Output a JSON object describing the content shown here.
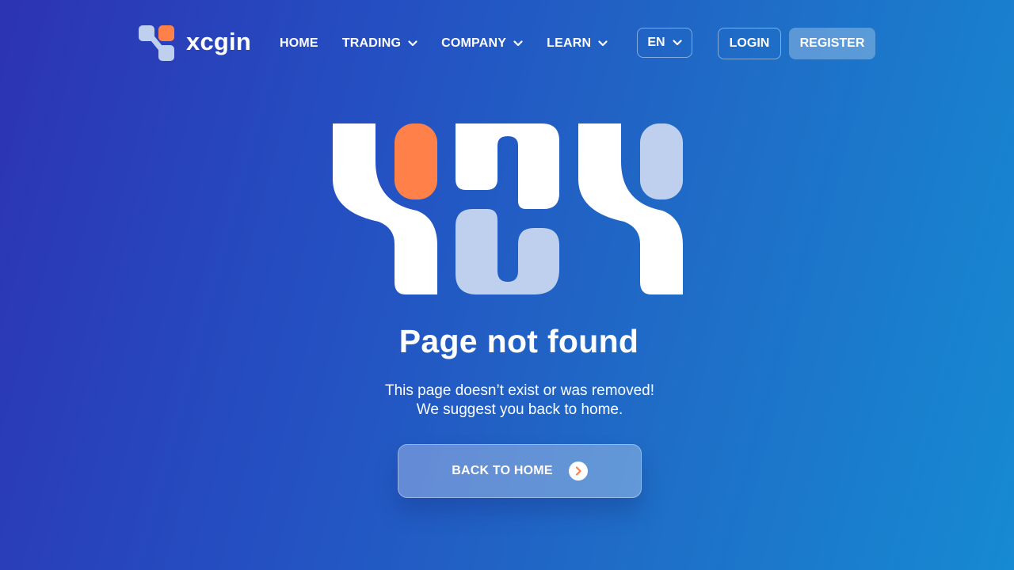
{
  "brand": {
    "name": "xcgin"
  },
  "nav": {
    "items": [
      {
        "label": "HOME",
        "dropdown": false
      },
      {
        "label": "TRADING",
        "dropdown": true
      },
      {
        "label": "COMPANY",
        "dropdown": true
      },
      {
        "label": "LEARN",
        "dropdown": true
      }
    ]
  },
  "language": {
    "selected": "EN"
  },
  "auth": {
    "login_label": "LOGIN",
    "register_label": "REGISTER"
  },
  "error": {
    "code_art": "404",
    "title": "Page not found",
    "message_line1": "This page doesn’t exist or was removed!",
    "message_line2": "We suggest you back to home.",
    "button_label": "BACK TO HOME"
  },
  "colors": {
    "accent": "#ff8048",
    "pale_blue": "#bed0ee",
    "white": "#ffffff"
  },
  "icons": [
    "logo-icon",
    "chevron-down-icon",
    "arrow-right-icon"
  ]
}
